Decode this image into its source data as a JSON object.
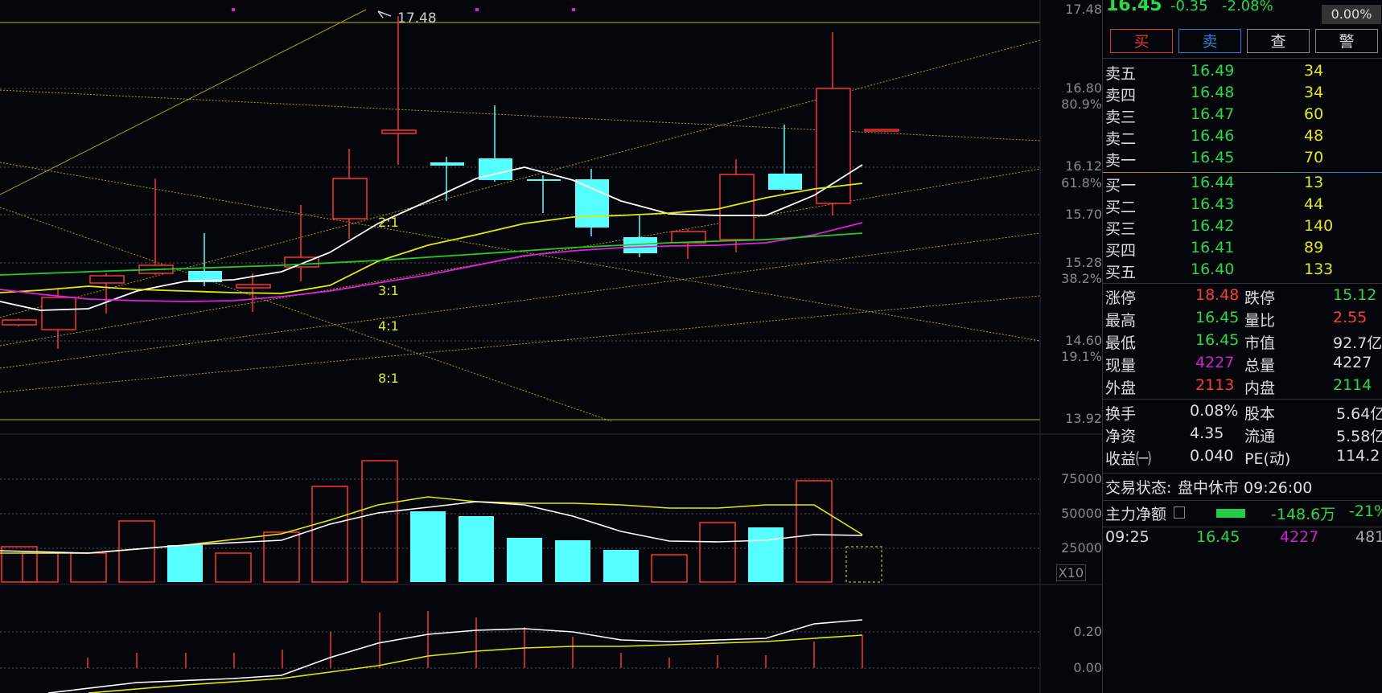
{
  "chart": {
    "price_axis": [
      "17.48",
      "16.80",
      "16.12",
      "15.70",
      "15.28",
      "14.60",
      "13.92"
    ],
    "pct_axis": [
      "80.9%",
      "61.8%",
      "38.2%",
      "19.1%"
    ],
    "high_label": "17.48",
    "fan_labels": [
      "2:1",
      "3:1",
      "4:1",
      "8:1"
    ],
    "vol_axis": [
      "75000",
      "50000",
      "25000"
    ],
    "vol_unit": "X10",
    "ind_axis": [
      "0.20",
      "0.00"
    ],
    "colors": {
      "up": "#ff3333",
      "down": "#55ffff",
      "ma_white": "#ffffff",
      "ma_yellow": "#e8e800",
      "ma_magenta": "#e020e0",
      "ma_green": "#22cc22"
    }
  },
  "header": {
    "price": "16.45",
    "change": "-0.35",
    "change_pct": "-2.08%",
    "box": "0.00%"
  },
  "buttons": [
    "买",
    "卖",
    "查",
    "警"
  ],
  "sell": [
    {
      "label": "卖五",
      "price": "16.49",
      "vol": "34"
    },
    {
      "label": "卖四",
      "price": "16.48",
      "vol": "34"
    },
    {
      "label": "卖三",
      "price": "16.47",
      "vol": "60"
    },
    {
      "label": "卖二",
      "price": "16.46",
      "vol": "48"
    },
    {
      "label": "卖一",
      "price": "16.45",
      "vol": "70"
    }
  ],
  "buy": [
    {
      "label": "买一",
      "price": "16.44",
      "vol": "13"
    },
    {
      "label": "买二",
      "price": "16.43",
      "vol": "44"
    },
    {
      "label": "买三",
      "price": "16.42",
      "vol": "140"
    },
    {
      "label": "买四",
      "price": "16.41",
      "vol": "89"
    },
    {
      "label": "买五",
      "price": "16.40",
      "vol": "133"
    }
  ],
  "stats": [
    {
      "l1": "涨停",
      "v1": "18.48",
      "l2": "跌停",
      "v2": "15.12"
    },
    {
      "l1": "最高",
      "v1": "16.45",
      "l2": "量比",
      "v2": "2.55"
    },
    {
      "l1": "最低",
      "v1": "16.45",
      "l2": "市值",
      "v2": "92.7亿"
    },
    {
      "l1": "现量",
      "v1": "4227",
      "l2": "总量",
      "v2": "4227"
    },
    {
      "l1": "外盘",
      "v1": "2113",
      "l2": "内盘",
      "v2": "2114"
    }
  ],
  "stats2": [
    {
      "l1": "换手",
      "v1": "0.08%",
      "l2": "股本",
      "v2": "5.64亿"
    },
    {
      "l1": "净资",
      "v1": "4.35",
      "l2": "流通",
      "v2": "5.58亿"
    },
    {
      "l1": "收益㈠",
      "v1": "0.040",
      "l2": "PE(动)",
      "v2": "114.2"
    }
  ],
  "status": {
    "label": "交易状态:",
    "value": "盘中休市 09:26:00"
  },
  "main_net": {
    "label": "主力净额",
    "value": "-148.6万",
    "pct": "-21%"
  },
  "tick": {
    "time": "09:25",
    "price": "16.45",
    "vol": "4227",
    "extra": "481"
  }
}
